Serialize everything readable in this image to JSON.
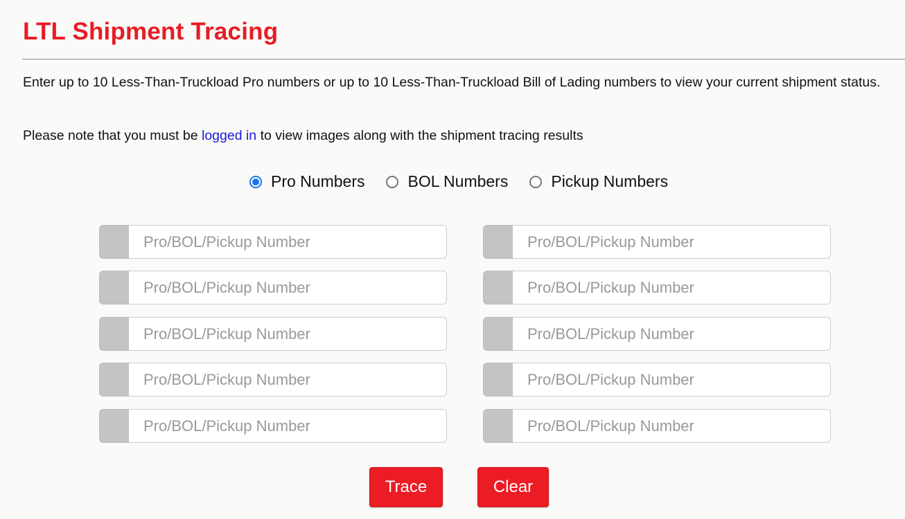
{
  "header": {
    "title": "LTL Shipment Tracing"
  },
  "intro": {
    "text": "Enter up to 10 Less-Than-Truckload Pro numbers or up to 10 Less-Than-Truckload Bill of Lading numbers to view your current shipment status."
  },
  "note": {
    "before": "Please note that you must be ",
    "link": "logged in",
    "after": " to view images along with the shipment tracing results"
  },
  "search_type": {
    "selected": "Pro Numbers",
    "options": [
      {
        "label": "Pro Numbers",
        "checked": true
      },
      {
        "label": "BOL Numbers",
        "checked": false
      },
      {
        "label": "Pickup Numbers",
        "checked": false
      }
    ]
  },
  "inputs": {
    "placeholder": "Pro/BOL/Pickup Number",
    "values": [
      "",
      "",
      "",
      "",
      "",
      "",
      "",
      "",
      "",
      ""
    ]
  },
  "actions": {
    "trace_label": "Trace",
    "clear_label": "Clear"
  },
  "colors": {
    "brand_red": "#e81c24",
    "link_blue": "#1a1ad6",
    "radio_blue": "#1a73e8"
  }
}
